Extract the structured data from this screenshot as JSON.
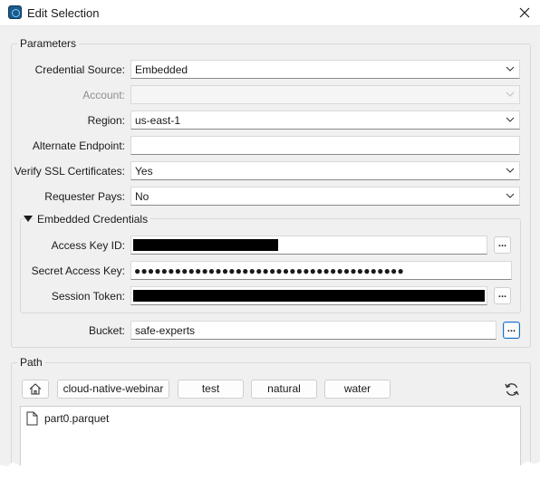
{
  "window": {
    "title": "Edit Selection"
  },
  "parameters": {
    "group_title": "Parameters",
    "credential_source": {
      "label": "Credential Source:",
      "value": "Embedded"
    },
    "account": {
      "label": "Account:",
      "value": ""
    },
    "region": {
      "label": "Region:",
      "value": "us-east-1"
    },
    "alternate_endpoint": {
      "label": "Alternate Endpoint:",
      "value": ""
    },
    "verify_ssl": {
      "label": "Verify SSL Certificates:",
      "value": "Yes"
    },
    "requester_pays": {
      "label": "Requester Pays:",
      "value": "No"
    },
    "embedded_credentials": {
      "title": "Embedded Credentials",
      "access_key_id": {
        "label": "Access Key ID:"
      },
      "secret_access_key": {
        "label": "Secret Access Key:",
        "value": "●●●●●●●●●●●●●●●●●●●●●●●●●●●●●●●●●●●●●●●●"
      },
      "session_token": {
        "label": "Session Token:"
      }
    },
    "bucket": {
      "label": "Bucket:",
      "value": "safe-experts"
    },
    "browse_label": "..."
  },
  "path": {
    "group_title": "Path",
    "crumbs": [
      "cloud-native-webinar",
      "test",
      "natural",
      "water"
    ],
    "files": [
      {
        "name": "part0.parquet",
        "icon": "file-icon"
      }
    ]
  }
}
